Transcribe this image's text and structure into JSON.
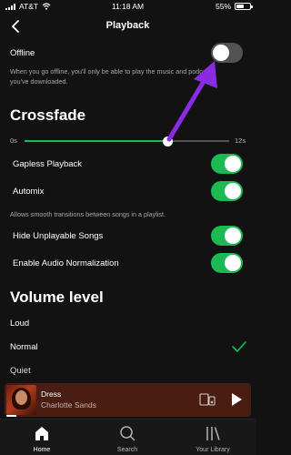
{
  "status_bar": {
    "carrier": "AT&T",
    "time": "11:18 AM",
    "battery_percent": "55%",
    "battery_level": 0.55
  },
  "header": {
    "title": "Playback",
    "back_icon": "chevron-left-icon"
  },
  "offline": {
    "label": "Offline",
    "enabled": false,
    "description_line1": "When you go offline, you'll only be able to play the music and podcasts",
    "description_line2": "you've downloaded."
  },
  "crossfade": {
    "title": "Crossfade",
    "min_label": "0s",
    "max_label": "12s",
    "min": 0,
    "max": 12,
    "value": 8.4
  },
  "settings": {
    "gapless": {
      "label": "Gapless Playback",
      "enabled": true
    },
    "automix": {
      "label": "Automix",
      "enabled": true,
      "description": "Allows smooth transitions between songs in a playlist."
    },
    "hide_unplayable": {
      "label": "Hide Unplayable Songs",
      "enabled": true
    },
    "normalization": {
      "label": "Enable Audio Normalization",
      "enabled": true
    }
  },
  "volume_level": {
    "title": "Volume level",
    "options": [
      {
        "label": "Loud",
        "selected": false
      },
      {
        "label": "Normal",
        "selected": true
      },
      {
        "label": "Quiet",
        "selected": false
      }
    ]
  },
  "now_playing": {
    "song": "Dress",
    "artist": "Charlotte Sands",
    "progress": 0.04
  },
  "nav": {
    "items": [
      {
        "label": "Home",
        "icon": "home-icon",
        "active": true
      },
      {
        "label": "Search",
        "icon": "search-icon",
        "active": false
      },
      {
        "label": "Your Library",
        "icon": "library-icon",
        "active": false
      }
    ]
  },
  "colors": {
    "accent": "#1db954",
    "background": "#121212",
    "player_bg": "#4a1d12",
    "annotation_arrow": "#8a2be2"
  }
}
